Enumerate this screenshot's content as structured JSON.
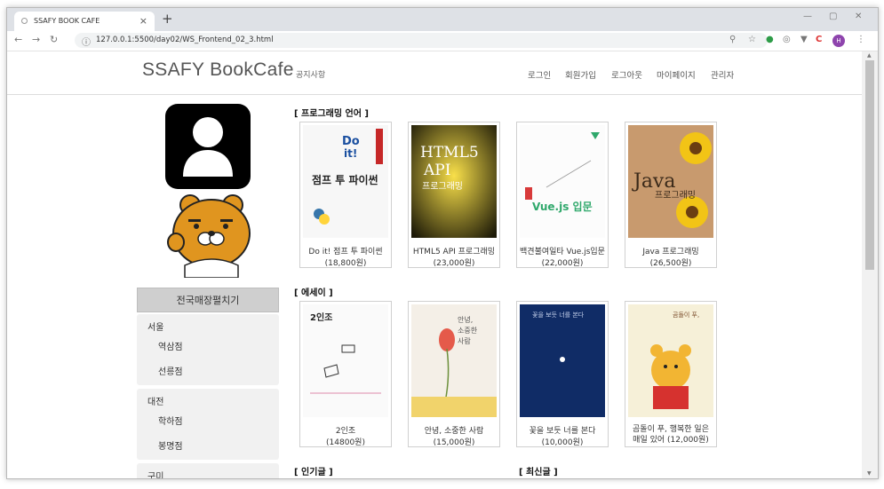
{
  "browser": {
    "tab_title": "SSAFY BOOK CAFE",
    "url": "127.0.0.1:5500/day02/WS_Frontend_02_3.html",
    "avatar_letter": "H"
  },
  "header": {
    "brand": "SSAFY BookCafe",
    "notice": "공지사항",
    "menu": [
      "로그인",
      "회원가입",
      "로그아웃",
      "마이페이지",
      "관리자"
    ]
  },
  "sidebar": {
    "branch_title": "전국매장펼치기",
    "regions": [
      {
        "name": "서울",
        "shops": [
          "역삼점",
          "선릉점"
        ]
      },
      {
        "name": "대전",
        "shops": [
          "학하점",
          "봉명점"
        ]
      },
      {
        "name": "구미",
        "shops": []
      }
    ]
  },
  "categories": {
    "programming": {
      "title": "[ 프로그래밍 언어 ]",
      "books": [
        {
          "name": "Do it! 점프 투 파이썬",
          "price": "(18,800원)",
          "cover_text": "점프 투 파이썬"
        },
        {
          "name": "HTML5 API 프로그래밍",
          "price": "(23,000원)",
          "cover_text": "HTML5 API 프로그래밍"
        },
        {
          "name": "백견불여일타 Vue.js입문",
          "price": "(22,000원)",
          "cover_text": "Vue.js 입문"
        },
        {
          "name": "Java 프로그래밍",
          "price": "(26,500원)",
          "cover_text": "Java 프로그래밍"
        }
      ]
    },
    "essay": {
      "title": "[ 에세이 ]",
      "books": [
        {
          "name": "2인조",
          "price": "(14800원)",
          "cover_text": "2인조"
        },
        {
          "name": "안녕, 소중한 사람",
          "price": "(15,000원)",
          "cover_text": "안녕, 소중한 사람"
        },
        {
          "name": "꽃을 보듯 너를 본다",
          "price": "(10,000원)",
          "cover_text": "꽃을 보듯 너를 본다"
        },
        {
          "name": "곰돌이 푸, 행복한 일은 매일 있어 (12,000원)",
          "price": "",
          "cover_text": "곰돌이 푸, 행복한 일은 매일 있어"
        }
      ]
    },
    "popular": {
      "title": "[ 인기글 ]"
    },
    "recent": {
      "title": "[ 최신글 ]"
    }
  }
}
